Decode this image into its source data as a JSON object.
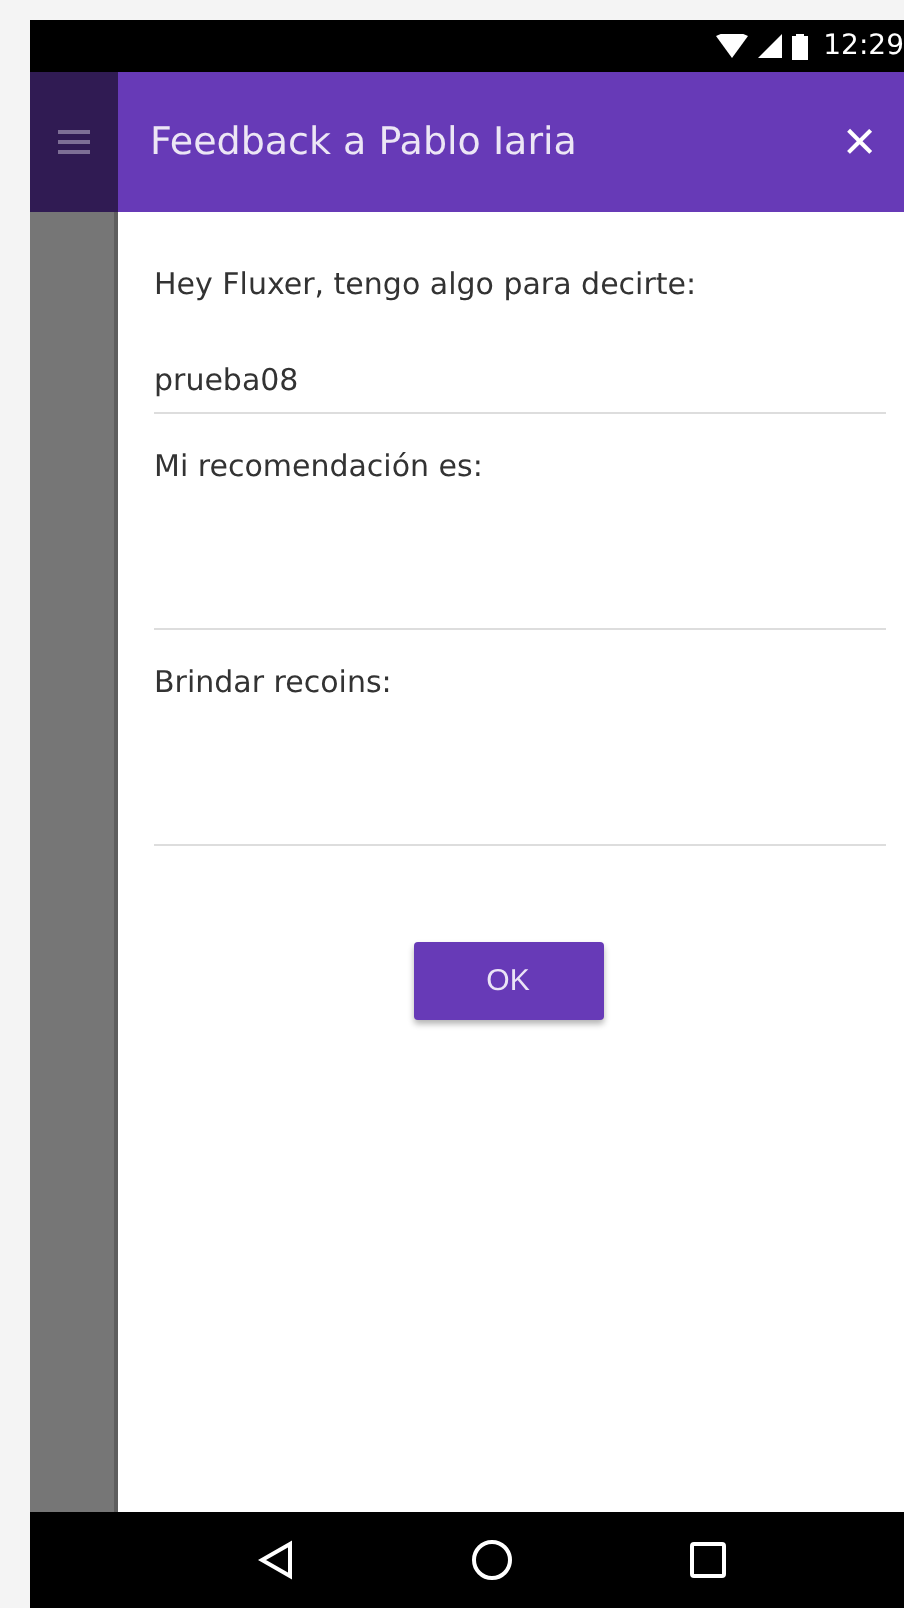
{
  "status_bar": {
    "time": "12:29"
  },
  "dialog": {
    "title": "Feedback a Pablo Iaria",
    "close": "×",
    "intro": "Hey Fluxer, tengo algo para decirte:",
    "fields": [
      {
        "value": "prueba08"
      },
      {
        "label": "Mi recomendación es:"
      },
      {
        "label": "Brindar recoins:"
      }
    ],
    "button": "OK"
  }
}
